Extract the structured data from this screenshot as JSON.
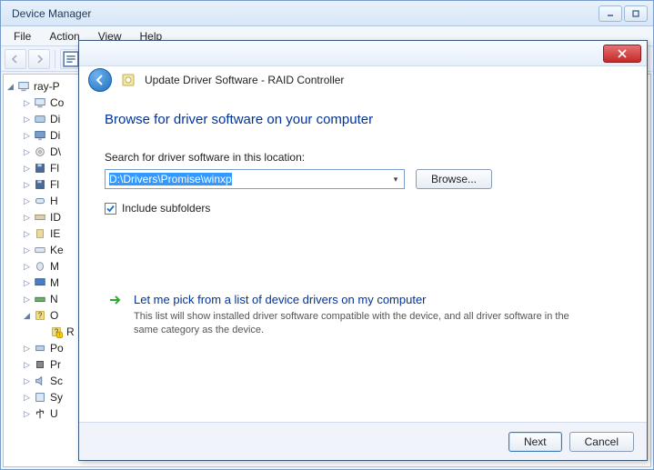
{
  "dm": {
    "title": "Device Manager",
    "menus": {
      "file": "File",
      "action": "Action",
      "view": "View",
      "help": "Help"
    },
    "root": "ray-P",
    "nodes": [
      {
        "label": "Co",
        "icon": "computer"
      },
      {
        "label": "Di",
        "icon": "disk"
      },
      {
        "label": "Di",
        "icon": "display"
      },
      {
        "label": "D\\",
        "icon": "dvd"
      },
      {
        "label": "Fl",
        "icon": "floppy"
      },
      {
        "label": "Fl",
        "icon": "floppy"
      },
      {
        "label": "H",
        "icon": "hid"
      },
      {
        "label": "ID",
        "icon": "ide"
      },
      {
        "label": "IE",
        "icon": "ieee"
      },
      {
        "label": "Ke",
        "icon": "keyboard"
      },
      {
        "label": "M",
        "icon": "mouse"
      },
      {
        "label": "M",
        "icon": "monitor"
      },
      {
        "label": "N",
        "icon": "network"
      },
      {
        "label": "O",
        "icon": "other",
        "expanded": true
      },
      {
        "label": "Po",
        "icon": "port"
      },
      {
        "label": "Pr",
        "icon": "processor"
      },
      {
        "label": "Sc",
        "icon": "sound"
      },
      {
        "label": "Sy",
        "icon": "system"
      },
      {
        "label": "U",
        "icon": "usb"
      }
    ],
    "other_child": "R"
  },
  "wizard": {
    "header_title": "Update Driver Software - RAID Controller",
    "heading": "Browse for driver software on your computer",
    "search_label": "Search for driver software in this location:",
    "path_value": "D:\\Drivers\\Promise\\winxp",
    "browse_label": "Browse...",
    "include_sub": "Include subfolders",
    "include_sub_checked": true,
    "pick_title": "Let me pick from a list of device drivers on my computer",
    "pick_desc": "This list will show installed driver software compatible with the device, and all driver software in the same category as the device.",
    "next_label": "Next",
    "cancel_label": "Cancel"
  }
}
